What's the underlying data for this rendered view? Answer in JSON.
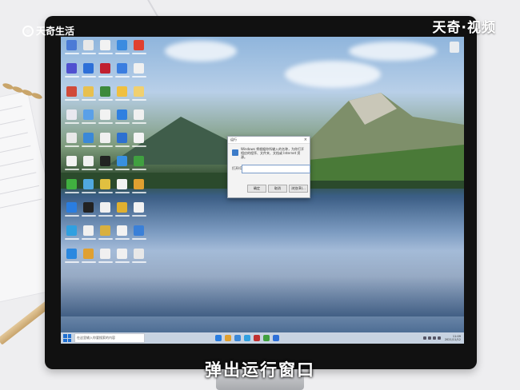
{
  "overlay": {
    "logo_text": "天奇生活",
    "brand_text": "天奇·视频",
    "caption": "弹出运行窗口"
  },
  "desktop": {
    "icon_colors": [
      "#4b7bd6",
      "#e8e8e8",
      "#f2f2f2",
      "#3b8be0",
      "#e04030",
      "#5050d0",
      "#2d6fd8",
      "#c02030",
      "#3a7de0",
      "#f0f0f0",
      "#d04a3a",
      "#e8c050",
      "#3c8a3c",
      "#f0c040",
      "#f0d070",
      "#e8e8f0",
      "#5aa0e8",
      "#f2f2f2",
      "#3080e0",
      "#f0f0f0",
      "#e8e8e8",
      "#3a88d8",
      "#f0f0f0",
      "#2d70d0",
      "#f4f4f4",
      "#f2f2f2",
      "#f0f0f0",
      "#222222",
      "#3890e0",
      "#40a040",
      "#40b040",
      "#50a8e0",
      "#e0c040",
      "#f2f2f2",
      "#e0a030",
      "#2a7de0",
      "#222222",
      "#f0f0f0",
      "#e0b030",
      "#f2f2f2",
      "#30a0e0",
      "#f0f0f0",
      "#d8b040",
      "#f2f2f2",
      "#3a80d8",
      "#2a88e0",
      "#e0a030",
      "#f0f0f0",
      "#f0f0f0",
      "#e8e8e8"
    ]
  },
  "run_dialog": {
    "title": "运行",
    "close_glyph": "×",
    "description": "Windows 将根据你所输入的名称，为你打开相应的程序、文件夹、文档或 Internet 资源。",
    "open_label": "打开(O):",
    "input_value": "",
    "ok_label": "确定",
    "cancel_label": "取消",
    "browse_label": "浏览(B)..."
  },
  "taskbar": {
    "search_placeholder": "在这里输入你要搜索的内容",
    "app_colors": [
      "#2a7de0",
      "#e0a030",
      "#3a88d8",
      "#30a0e0",
      "#c03030",
      "#40a040",
      "#2d6fd8"
    ],
    "time": "11:09",
    "date": "2021/11/12"
  }
}
